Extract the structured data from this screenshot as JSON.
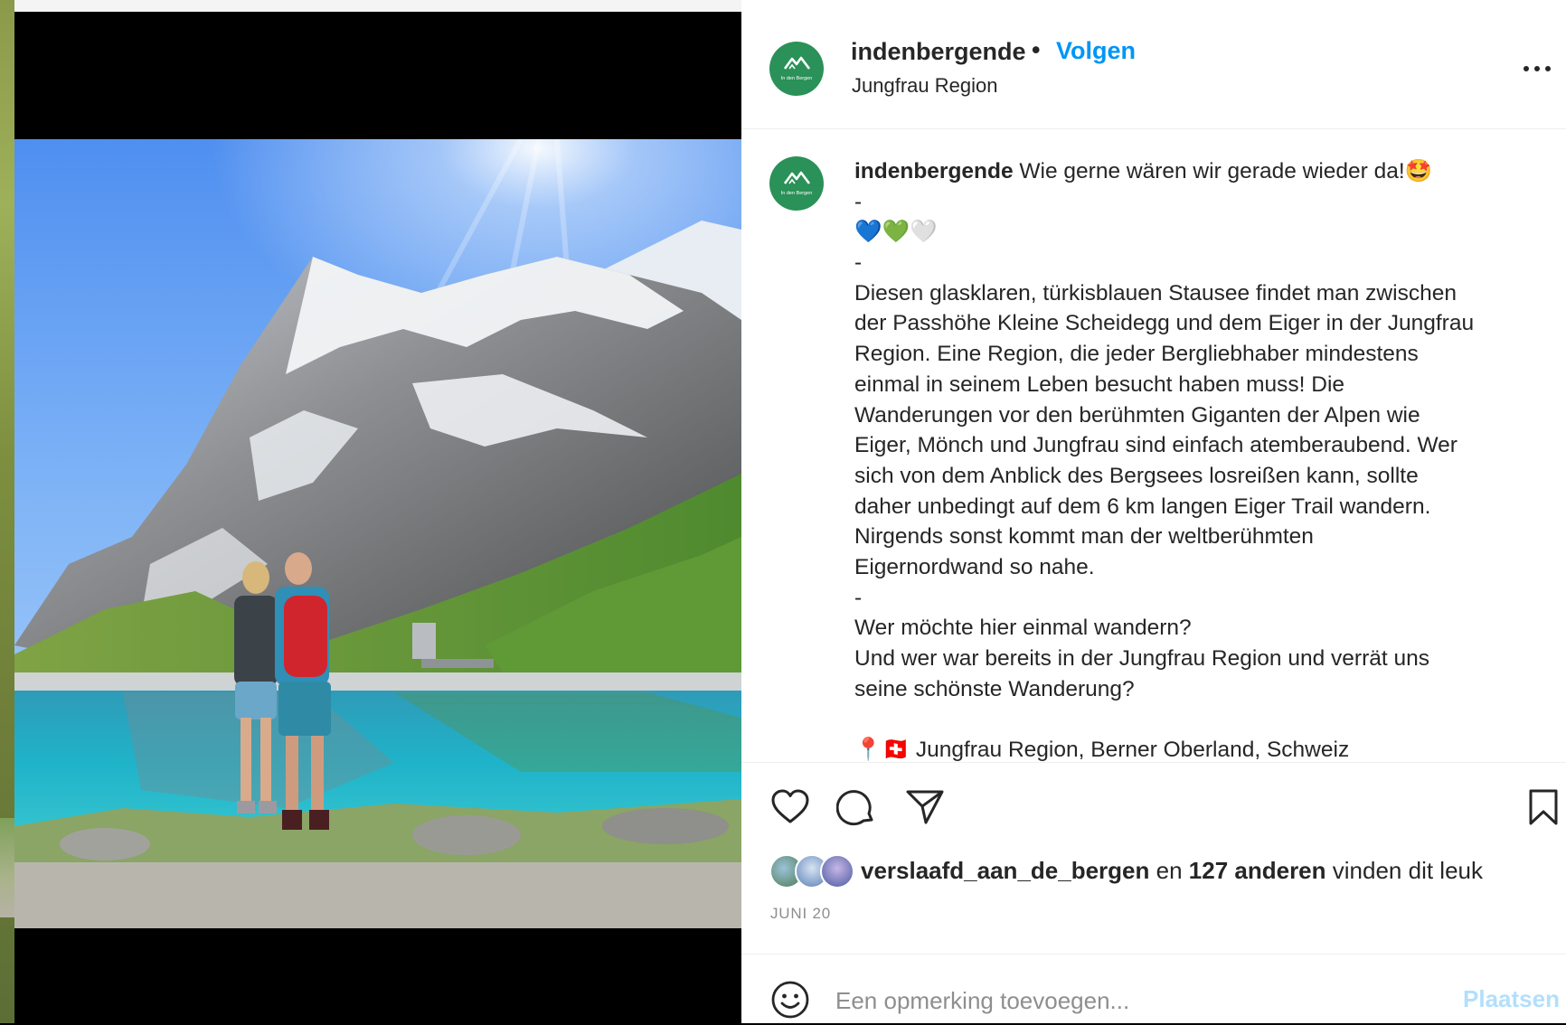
{
  "post": {
    "username": "indenbergende",
    "separator": "•",
    "follow_label": "Volgen",
    "location": "Jungfrau Region",
    "avatar_text": "In den Bergen",
    "more_icon": "more-horizontal-icon"
  },
  "caption": {
    "username": "indenbergende",
    "first_line": "Wie gerne wären wir gerade wieder da!🤩",
    "lines": [
      "-",
      "💙💚🤍",
      "-",
      "Diesen glasklaren, türkisblauen Stausee findet man zwischen",
      "der Passhöhe Kleine Scheidegg und dem Eiger in der Jungfrau",
      "Region. Eine Region, die jeder Bergliebhaber mindestens",
      "einmal in seinem Leben besucht haben muss! Die",
      "Wanderungen vor den berühmten Giganten der Alpen wie",
      "Eiger, Mönch und Jungfrau sind einfach atemberaubend. Wer",
      "sich von dem Anblick des Bergsees losreißen kann, sollte",
      "daher unbedingt auf dem 6 km langen Eiger Trail wandern.",
      "Nirgends sonst kommt man der weltberühmten",
      "Eigernordwand so nahe.",
      "-",
      "Wer möchte hier einmal wandern?",
      "Und wer war bereits in der Jungfrau Region und verrät uns",
      "seine schönste Wanderung?",
      "",
      "📍🇨🇭 Jungfrau Region, Berner Oberland, Schweiz"
    ]
  },
  "actions": {
    "like_icon": "heart-icon",
    "comment_icon": "comment-bubble-icon",
    "share_icon": "paper-plane-icon",
    "save_icon": "bookmark-icon"
  },
  "likes": {
    "first_liker": "verslaafd_aan_de_bergen",
    "connector": "en",
    "others": "127 anderen",
    "suffix": "vinden dit leuk"
  },
  "date": "JUNI 20",
  "comment": {
    "emoji_icon": "smiley-icon",
    "placeholder": "Een opmerking toevoegen...",
    "post_label": "Plaatsen"
  },
  "colors": {
    "link": "#0095f6",
    "post_disabled": "#b2dffc",
    "avatar_green": "#2a9158",
    "text": "#262626",
    "muted": "#8e8e8e"
  }
}
